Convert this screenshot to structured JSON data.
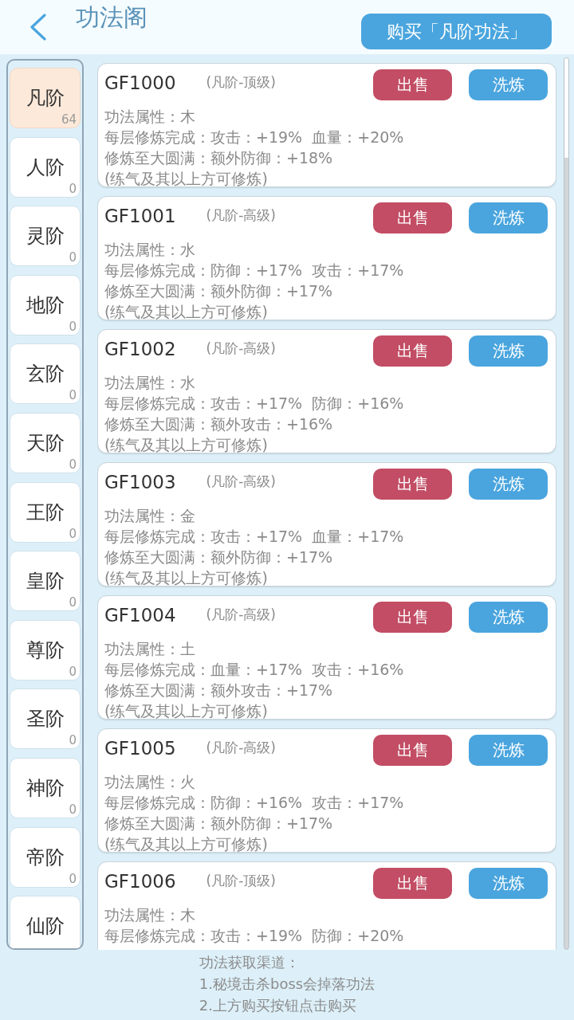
{
  "header": {
    "title": "功法阁",
    "buy_button": "购买「凡阶功法」"
  },
  "sidebar": {
    "items": [
      {
        "label": "凡阶",
        "count": "64",
        "selected": true
      },
      {
        "label": "人阶",
        "count": "0",
        "selected": false
      },
      {
        "label": "灵阶",
        "count": "0",
        "selected": false
      },
      {
        "label": "地阶",
        "count": "0",
        "selected": false
      },
      {
        "label": "玄阶",
        "count": "0",
        "selected": false
      },
      {
        "label": "天阶",
        "count": "0",
        "selected": false
      },
      {
        "label": "王阶",
        "count": "0",
        "selected": false
      },
      {
        "label": "皇阶",
        "count": "0",
        "selected": false
      },
      {
        "label": "尊阶",
        "count": "0",
        "selected": false
      },
      {
        "label": "圣阶",
        "count": "0",
        "selected": false
      },
      {
        "label": "神阶",
        "count": "0",
        "selected": false
      },
      {
        "label": "帝阶",
        "count": "0",
        "selected": false
      },
      {
        "label": "仙阶",
        "selected": false
      }
    ]
  },
  "cards": [
    {
      "code": "GF1000",
      "grade": "(凡阶-顶级)",
      "sell_button": "出售",
      "refine_button": "洗炼",
      "lines": [
        "功法属性：木",
        "每层修炼完成：攻击：+19%  血量：+20%",
        "修炼至大圆满：额外防御：+18%",
        "(练气及其以上方可修炼)"
      ]
    },
    {
      "code": "GF1001",
      "grade": "(凡阶-高级)",
      "sell_button": "出售",
      "refine_button": "洗炼",
      "lines": [
        "功法属性：水",
        "每层修炼完成：防御：+17%  攻击：+17%",
        "修炼至大圆满：额外防御：+17%",
        "(练气及其以上方可修炼)"
      ]
    },
    {
      "code": "GF1002",
      "grade": "(凡阶-高级)",
      "sell_button": "出售",
      "refine_button": "洗炼",
      "lines": [
        "功法属性：水",
        "每层修炼完成：攻击：+17%  防御：+16%",
        "修炼至大圆满：额外攻击：+16%",
        "(练气及其以上方可修炼)"
      ]
    },
    {
      "code": "GF1003",
      "grade": "(凡阶-高级)",
      "sell_button": "出售",
      "refine_button": "洗炼",
      "lines": [
        "功法属性：金",
        "每层修炼完成：攻击：+17%  血量：+17%",
        "修炼至大圆满：额外防御：+17%",
        "(练气及其以上方可修炼)"
      ]
    },
    {
      "code": "GF1004",
      "grade": "(凡阶-高级)",
      "sell_button": "出售",
      "refine_button": "洗炼",
      "lines": [
        "功法属性：土",
        "每层修炼完成：血量：+17%  攻击：+16%",
        "修炼至大圆满：额外攻击：+17%",
        "(练气及其以上方可修炼)"
      ]
    },
    {
      "code": "GF1005",
      "grade": "(凡阶-高级)",
      "sell_button": "出售",
      "refine_button": "洗炼",
      "lines": [
        "功法属性：火",
        "每层修炼完成：防御：+16%  攻击：+17%",
        "修炼至大圆满：额外防御：+17%",
        "(练气及其以上方可修炼)"
      ]
    },
    {
      "code": "GF1006",
      "grade": "(凡阶-顶级)",
      "sell_button": "出售",
      "refine_button": "洗炼",
      "lines": [
        "功法属性：木",
        "每层修炼完成：攻击：+19%  防御：+20%"
      ]
    }
  ],
  "footer": {
    "lines": [
      "功法获取渠道：",
      "1.秘境击杀boss会掉落功法",
      "2.上方购买按钮点击购买"
    ]
  }
}
